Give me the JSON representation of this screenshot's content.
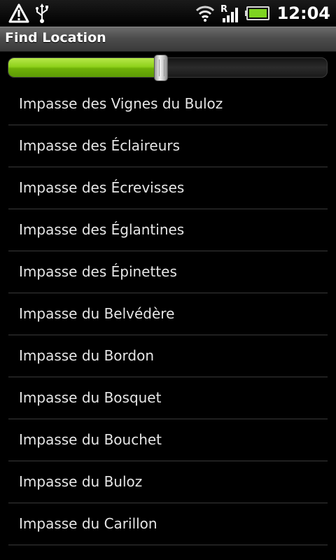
{
  "status_bar": {
    "left_icons": [
      "warning-icon",
      "usb-icon"
    ],
    "right_icons": [
      "wifi-icon",
      "roaming-signal-icon",
      "battery-icon"
    ],
    "roaming_letter": "R",
    "time": "12:04",
    "battery_color": "#7ed321"
  },
  "title_bar": {
    "title": "Find Location"
  },
  "slider": {
    "value": 0.48,
    "fill_color": "#8fd21b"
  },
  "locations": [
    "Impasse des Vignes du Buloz",
    "Impasse des Éclaireurs",
    "Impasse des Écrevisses",
    "Impasse des Églantines",
    "Impasse des Épinettes",
    "Impasse du Belvédère",
    "Impasse du Bordon",
    "Impasse du Bosquet",
    "Impasse du Bouchet",
    "Impasse du Buloz",
    "Impasse du Carillon"
  ]
}
